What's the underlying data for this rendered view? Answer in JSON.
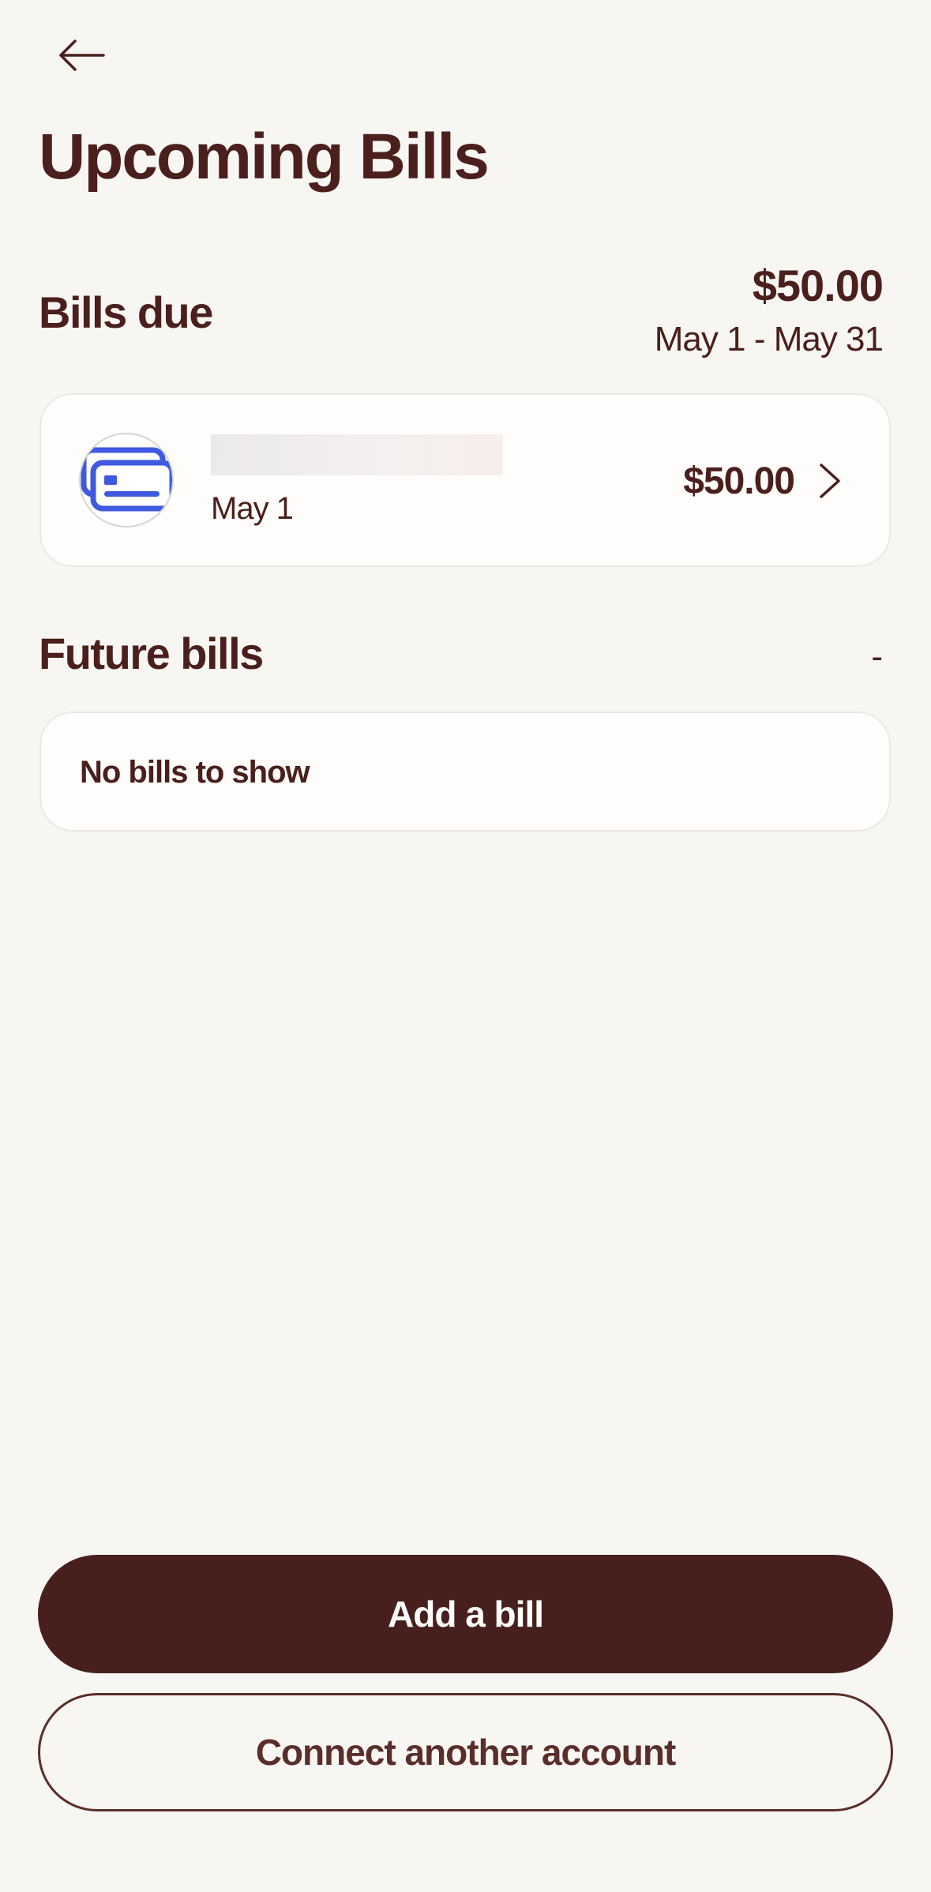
{
  "header": {
    "back_icon": "arrow-left-icon",
    "title": "Upcoming Bills"
  },
  "bills_due": {
    "title": "Bills due",
    "total": "$50.00",
    "range": "May 1 - May 31",
    "items": [
      {
        "icon": "credit-card-icon",
        "date": "May 1",
        "amount": "$50.00"
      }
    ]
  },
  "future_bills": {
    "title": "Future bills",
    "total": "-",
    "empty_text": "No bills to show"
  },
  "actions": {
    "add_bill_label": "Add a bill",
    "connect_account_label": "Connect another account"
  },
  "colors": {
    "background": "#f8f6f3",
    "text": "#4a1f1c",
    "primary_button": "#47201d",
    "card": "#fefdfc",
    "icon_blue": "#3f5ae0"
  }
}
